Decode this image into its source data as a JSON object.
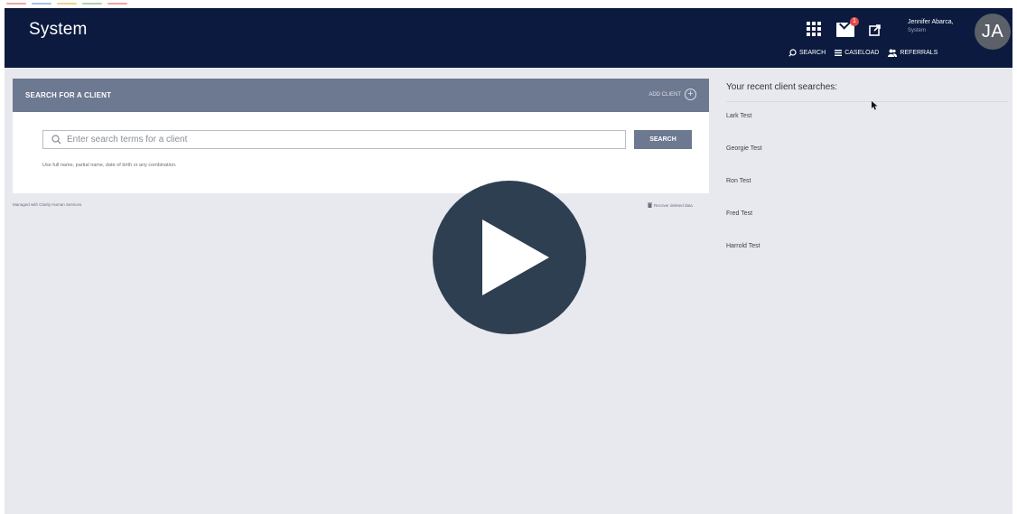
{
  "header": {
    "brand": "System",
    "mail_badge": "1",
    "user_name": "Jennifer Abarca,",
    "user_role": "System",
    "avatar_initials": "JA",
    "nav": [
      {
        "label": "SEARCH",
        "icon": "search-icon"
      },
      {
        "label": "CASELOAD",
        "icon": "list-icon"
      },
      {
        "label": "REFERRALS",
        "icon": "people-icon"
      }
    ],
    "icons": [
      "apps-grid-icon",
      "mail-icon",
      "external-link-icon"
    ],
    "background": "#0b1a3e"
  },
  "search_panel": {
    "title": "SEARCH FOR A CLIENT",
    "add_client_label": "ADD CLIENT",
    "search_placeholder": "Enter search terms for a client",
    "search_value": "",
    "search_button_label": "SEARCH",
    "hint": "Use full name, partial name, date of birth or any combination.",
    "header_color": "#6d7891"
  },
  "footer": {
    "powered_by": "Managed with Clarity Human Services",
    "recover": "Recover deleted data"
  },
  "recent": {
    "title": "Your recent client searches:",
    "items": [
      "Lark Test",
      "Georgie Test",
      "Ron Test",
      "Fred Test",
      "Harrold Test"
    ]
  },
  "video_overlay": {
    "icon": "play-icon",
    "color": "#2e3f52"
  }
}
